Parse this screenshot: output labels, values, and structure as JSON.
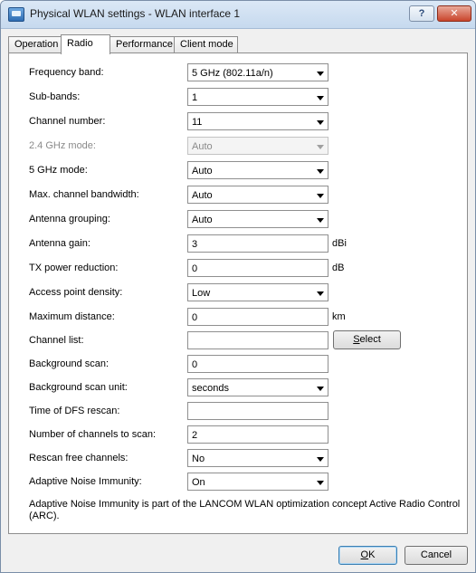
{
  "window": {
    "title": "Physical WLAN settings - WLAN interface 1",
    "help_label": "?",
    "close_label": "✕"
  },
  "tabs": [
    {
      "label": "Operation",
      "active": false
    },
    {
      "label": "Radio",
      "active": true
    },
    {
      "label": "Performance",
      "active": false
    },
    {
      "label": "Client mode",
      "active": false
    }
  ],
  "fields": {
    "frequency_band": {
      "label": "Frequency band:",
      "value": "5 GHz (802.11a/n)"
    },
    "sub_bands": {
      "label": "Sub-bands:",
      "value": "1"
    },
    "channel_number": {
      "label": "Channel number:",
      "value": "11"
    },
    "ghz24_mode": {
      "label": "2.4 GHz mode:",
      "value": "Auto"
    },
    "ghz5_mode": {
      "label": "5 GHz mode:",
      "value": "Auto"
    },
    "max_channel_bandwidth": {
      "label": "Max. channel bandwidth:",
      "value": "Auto"
    },
    "antenna_grouping": {
      "label": "Antenna grouping:",
      "value": "Auto"
    },
    "antenna_gain": {
      "label": "Antenna gain:",
      "value": "3",
      "unit": "dBi"
    },
    "tx_power_reduction": {
      "label": "TX power reduction:",
      "value": "0",
      "unit": "dB"
    },
    "access_point_density": {
      "label": "Access point density:",
      "value": "Low"
    },
    "maximum_distance": {
      "label": "Maximum distance:",
      "value": "0",
      "unit": "km"
    },
    "channel_list": {
      "label": "Channel list:",
      "value": "",
      "button_prefix": "S",
      "button_rest": "elect"
    },
    "background_scan": {
      "label": "Background scan:",
      "value": "0"
    },
    "background_scan_unit": {
      "label": "Background scan unit:",
      "value": "seconds"
    },
    "time_of_dfs_rescan": {
      "label": "Time of DFS rescan:",
      "value": ""
    },
    "channels_to_scan": {
      "label": "Number of channels to scan:",
      "value": "2"
    },
    "rescan_free_channels": {
      "label": "Rescan free channels:",
      "value": "No"
    },
    "adaptive_noise_immunity": {
      "label": "Adaptive Noise Immunity:",
      "value": "On"
    }
  },
  "note": "Adaptive Noise Immunity is part of the LANCOM WLAN optimization concept Active Radio Control (ARC).",
  "buttons": {
    "ok_prefix": "O",
    "ok_rest": "K",
    "cancel": "Cancel"
  }
}
